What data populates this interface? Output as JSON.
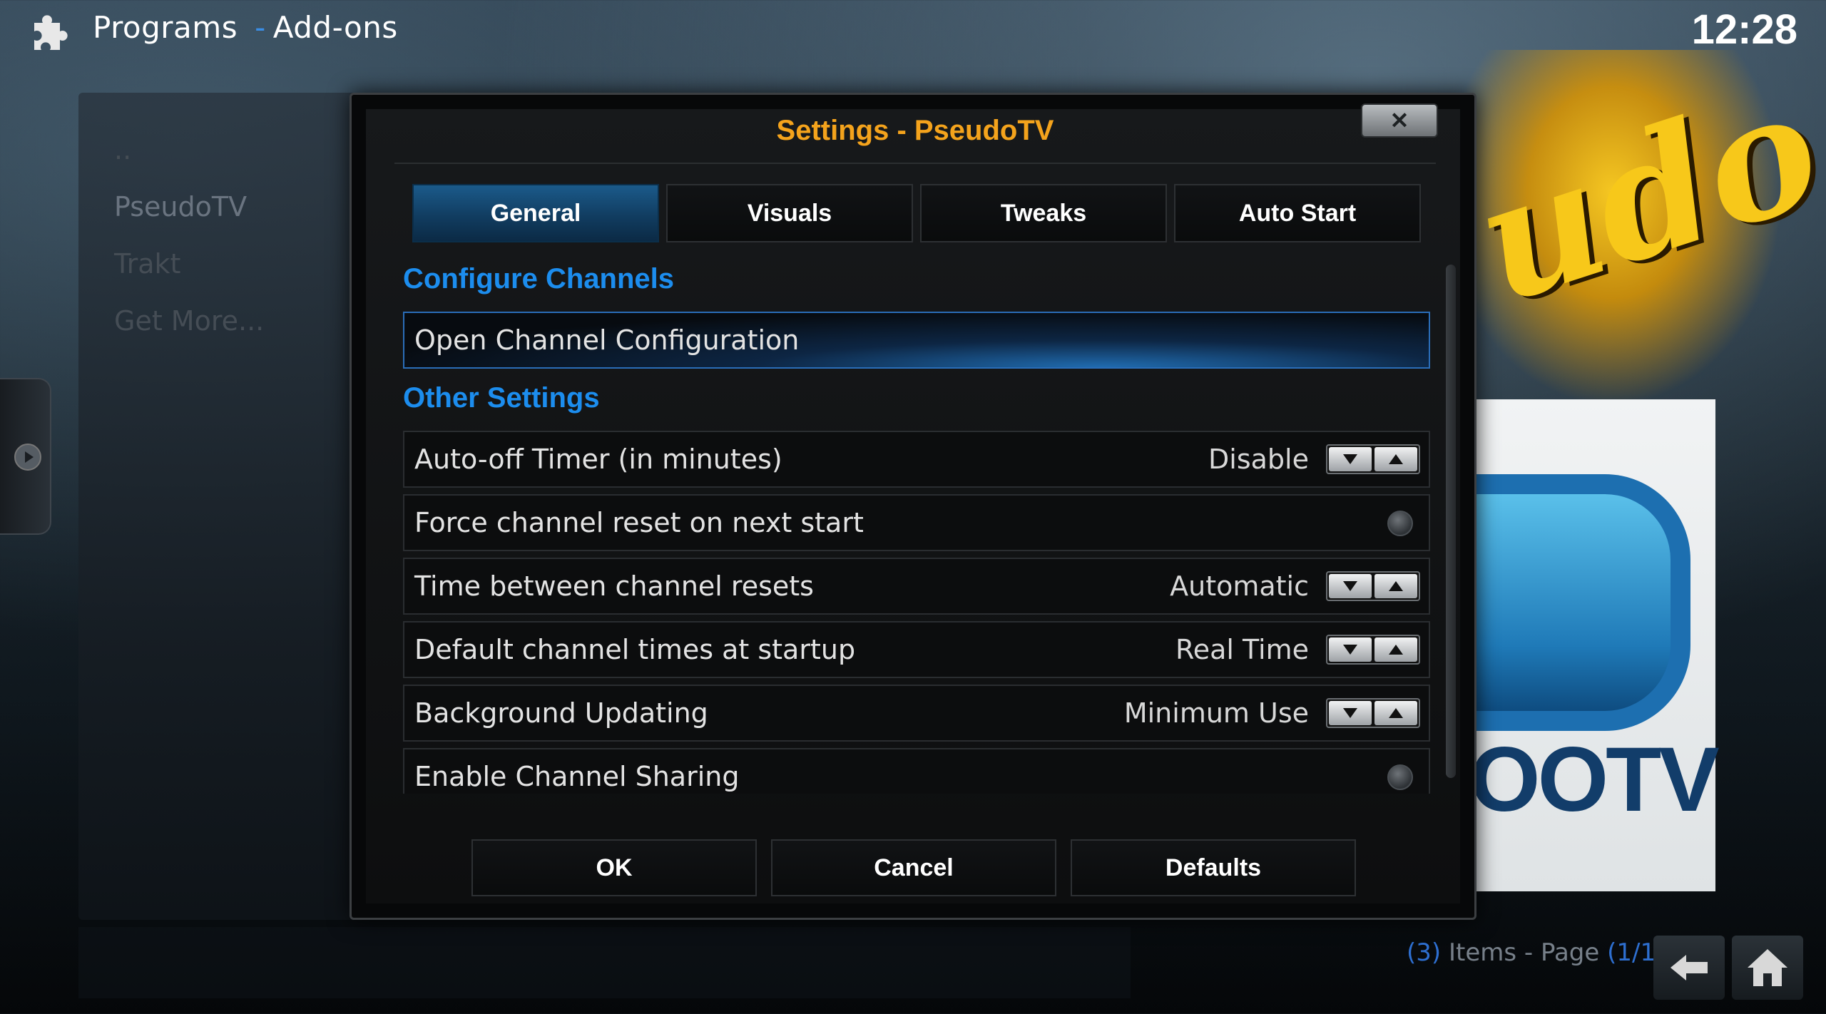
{
  "header": {
    "section": "Programs",
    "separator": "-",
    "subsection": "Add-ons",
    "clock": "12:28"
  },
  "background_list": {
    "items": [
      {
        "label": ".."
      },
      {
        "label": "PseudoTV"
      },
      {
        "label": "Trakt"
      },
      {
        "label": "Get More..."
      }
    ]
  },
  "fanart": {
    "logo_text": "udo",
    "poster_text": "OOTV"
  },
  "footer_info": {
    "count_open": "(",
    "count": "3",
    "count_close": ")",
    "items_text": " Items - Page ",
    "page_open": "(",
    "page": "1/1",
    "page_close": ")"
  },
  "dialog": {
    "title": "Settings - PseudoTV",
    "close_label": "✕",
    "tabs": [
      {
        "label": "General",
        "active": true
      },
      {
        "label": "Visuals",
        "active": false
      },
      {
        "label": "Tweaks",
        "active": false
      },
      {
        "label": "Auto Start",
        "active": false
      }
    ],
    "sections": {
      "configure": "Configure Channels",
      "other": "Other Settings"
    },
    "open_channel_config": "Open Channel Configuration",
    "settings": [
      {
        "label": "Auto-off Timer (in minutes)",
        "value": "Disable",
        "control": "spinner"
      },
      {
        "label": "Force channel reset on next start",
        "value": "",
        "control": "radio"
      },
      {
        "label": "Time between channel resets",
        "value": "Automatic",
        "control": "spinner"
      },
      {
        "label": "Default channel times at startup",
        "value": "Real Time",
        "control": "spinner"
      },
      {
        "label": "Background Updating",
        "value": "Minimum Use",
        "control": "spinner"
      },
      {
        "label": "Enable Channel Sharing",
        "value": "",
        "control": "radio"
      }
    ],
    "buttons": {
      "ok": "OK",
      "cancel": "Cancel",
      "defaults": "Defaults"
    }
  },
  "colors": {
    "accent_blue": "#1c8dee",
    "title_orange": "#f4a31c",
    "focus_blue": "#2a6db8"
  }
}
